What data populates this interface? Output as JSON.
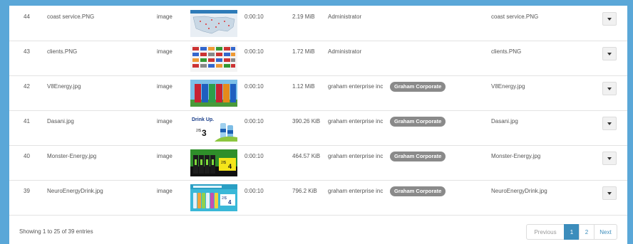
{
  "rows": [
    {
      "id": "44",
      "name": "coast service.PNG",
      "type": "image",
      "thumb": "map-thumbnail",
      "duration": "0:00:10",
      "size": "2.19 MiB",
      "user": "Administrator",
      "tag": "",
      "title": "coast service.PNG"
    },
    {
      "id": "43",
      "name": "clients.PNG",
      "type": "image",
      "thumb": "logos-thumbnail",
      "duration": "0:00:10",
      "size": "1.72 MiB",
      "user": "Administrator",
      "tag": "",
      "title": "clients.PNG"
    },
    {
      "id": "42",
      "name": "V8Energy.jpg",
      "type": "image",
      "thumb": "v8-thumbnail",
      "duration": "0:00:10",
      "size": "1.12 MiB",
      "user": "graham enterprise inc",
      "tag": "Graham Corporate",
      "title": "V8Energy.jpg"
    },
    {
      "id": "41",
      "name": "Dasani.jpg",
      "type": "image",
      "thumb": "dasani-thumbnail",
      "duration": "0:00:10",
      "size": "390.26 KiB",
      "user": "graham enterprise inc",
      "tag": "Graham Corporate",
      "title": "Dasani.jpg"
    },
    {
      "id": "40",
      "name": "Monster-Energy.jpg",
      "type": "image",
      "thumb": "monster-thumbnail",
      "duration": "0:00:10",
      "size": "464.57 KiB",
      "user": "graham enterprise inc",
      "tag": "Graham Corporate",
      "title": "Monster-Energy.jpg"
    },
    {
      "id": "39",
      "name": "NeuroEnergyDrink.jpg",
      "type": "image",
      "thumb": "neuro-thumbnail",
      "duration": "0:00:10",
      "size": "796.2 KiB",
      "user": "graham enterprise inc",
      "tag": "Graham Corporate",
      "title": "NeuroEnergyDrink.jpg"
    }
  ],
  "thumb_text": {
    "dasani_title": "Drink Up.",
    "dasani_price_prefix": "2/$",
    "dasani_price": "3",
    "monster_price_prefix": "2/$",
    "monster_price": "4",
    "neuro_price_prefix": "2/$",
    "neuro_price": "4"
  },
  "footer": {
    "info": "Showing 1 to 25 of 39 entries",
    "pager": {
      "previous": "Previous",
      "page1": "1",
      "page2": "2",
      "next": "Next"
    }
  },
  "colors": {
    "frame": "#5aa7d8",
    "badge": "#8a8a8a",
    "active_page": "#3c8dbc"
  }
}
